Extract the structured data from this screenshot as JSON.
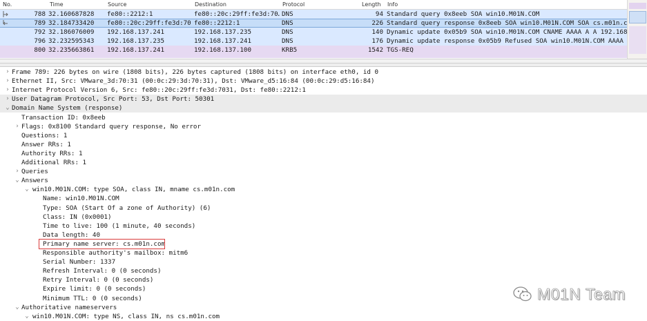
{
  "packet_list": {
    "headers": {
      "no": "No.",
      "time": "Time",
      "source": "Source",
      "destination": "Destination",
      "protocol": "Protocol",
      "length": "Length",
      "info": "Info"
    },
    "rows": [
      {
        "no": "788",
        "time": "32.160687828",
        "source": "fe80::2212:1",
        "destination": "fe80::20c:29ff:fe3d:70…",
        "protocol": "DNS",
        "length": "94",
        "info": "Standard query 0x8eeb SOA win10.M01N.COM"
      },
      {
        "no": "789",
        "time": "32.184733420",
        "source": "fe80::20c:29ff:fe3d:70…",
        "destination": "fe80::2212:1",
        "protocol": "DNS",
        "length": "226",
        "info": "Standard query response 0x8eeb SOA win10.M01N.COM SOA cs.m01n.com N"
      },
      {
        "no": "792",
        "time": "32.186076009",
        "source": "192.168.137.241",
        "destination": "192.168.137.235",
        "protocol": "DNS",
        "length": "140",
        "info": "Dynamic update 0x05b9 SOA win10.M01N.COM CNAME AAAA A A 192.168.137"
      },
      {
        "no": "796",
        "time": "32.232595343",
        "source": "192.168.137.235",
        "destination": "192.168.137.241",
        "protocol": "DNS",
        "length": "176",
        "info": "Dynamic update response 0x05b9 Refused SOA win10.M01N.COM AAAA :: A"
      },
      {
        "no": "800",
        "time": "32.235663861",
        "source": "192.168.137.241",
        "destination": "192.168.137.100",
        "protocol": "KRB5",
        "length": "1542",
        "info": "TGS-REQ"
      }
    ]
  },
  "details": [
    {
      "indent": 0,
      "toggle": "›",
      "text": "Frame 789: 226 bytes on wire (1808 bits), 226 bytes captured (1808 bits) on interface eth0, id 0"
    },
    {
      "indent": 0,
      "toggle": "›",
      "text": "Ethernet II, Src: VMware_3d:70:31 (00:0c:29:3d:70:31), Dst: VMware_d5:16:84 (00:0c:29:d5:16:84)"
    },
    {
      "indent": 0,
      "toggle": "›",
      "text": "Internet Protocol Version 6, Src: fe80::20c:29ff:fe3d:7031, Dst: fe80::2212:1"
    },
    {
      "indent": 0,
      "toggle": "›",
      "text": "User Datagram Protocol, Src Port: 53, Dst Port: 50301"
    },
    {
      "indent": 0,
      "toggle": "⌄",
      "text": "Domain Name System (response)"
    },
    {
      "indent": 1,
      "toggle": "",
      "text": "Transaction ID: 0x8eeb"
    },
    {
      "indent": 1,
      "toggle": "›",
      "text": "Flags: 0x8100 Standard query response, No error"
    },
    {
      "indent": 1,
      "toggle": "",
      "text": "Questions: 1"
    },
    {
      "indent": 1,
      "toggle": "",
      "text": "Answer RRs: 1"
    },
    {
      "indent": 1,
      "toggle": "",
      "text": "Authority RRs: 1"
    },
    {
      "indent": 1,
      "toggle": "",
      "text": "Additional RRs: 1"
    },
    {
      "indent": 1,
      "toggle": "›",
      "text": "Queries"
    },
    {
      "indent": 1,
      "toggle": "⌄",
      "text": "Answers"
    },
    {
      "indent": 2,
      "toggle": "⌄",
      "text": "win10.M01N.COM: type SOA, class IN, mname cs.m01n.com"
    },
    {
      "indent": 3,
      "toggle": "",
      "text": "Name: win10.M01N.COM"
    },
    {
      "indent": 3,
      "toggle": "",
      "text": "Type: SOA (Start Of a zone of Authority) (6)"
    },
    {
      "indent": 3,
      "toggle": "",
      "text": "Class: IN (0x0001)"
    },
    {
      "indent": 3,
      "toggle": "",
      "text": "Time to live: 100 (1 minute, 40 seconds)"
    },
    {
      "indent": 3,
      "toggle": "",
      "text": "Data length: 40"
    },
    {
      "indent": 3,
      "toggle": "",
      "text": "Primary name server: cs.m01n.com"
    },
    {
      "indent": 3,
      "toggle": "",
      "text": "Responsible authority's mailbox: mitm6"
    },
    {
      "indent": 3,
      "toggle": "",
      "text": "Serial Number: 1337"
    },
    {
      "indent": 3,
      "toggle": "",
      "text": "Refresh Interval: 0 (0 seconds)"
    },
    {
      "indent": 3,
      "toggle": "",
      "text": "Retry Interval: 0 (0 seconds)"
    },
    {
      "indent": 3,
      "toggle": "",
      "text": "Expire limit: 0 (0 seconds)"
    },
    {
      "indent": 3,
      "toggle": "",
      "text": "Minimum TTL: 0 (0 seconds)"
    },
    {
      "indent": 1,
      "toggle": "⌄",
      "text": "Authoritative nameservers"
    },
    {
      "indent": 2,
      "toggle": "⌄",
      "text": "win10.M01N.COM: type NS, class IN, ns cs.m01n.com"
    }
  ],
  "watermark": {
    "text": "M01N Team",
    "icon": "wechat-icon"
  },
  "colors": {
    "dns_row": "#dae9ff",
    "selected_row": "#c6ddf8",
    "krb_row": "#e6d9f2",
    "highlight_box": "#d93b3b"
  }
}
